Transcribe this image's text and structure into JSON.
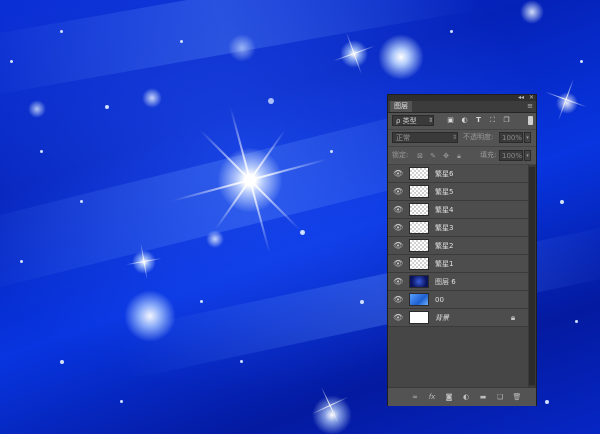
{
  "panel": {
    "tab_label": "图层",
    "kind_filter": "ρ 类型",
    "blend_mode": "正常",
    "opacity_label": "不透明度:",
    "opacity_value": "100%",
    "lock_label": "锁定:",
    "fill_label": "填充:",
    "fill_value": "100%"
  },
  "filter_icons": [
    "image-filter-icon",
    "adjustment-filter-icon",
    "type-filter-icon",
    "shape-filter-icon",
    "smart-object-filter-icon"
  ],
  "lock_icons": [
    "lock-transparent-icon",
    "lock-image-icon",
    "lock-position-icon",
    "lock-all-icon"
  ],
  "layers": [
    {
      "name": "繁星6",
      "thumb": "checker"
    },
    {
      "name": "繁星5",
      "thumb": "checker"
    },
    {
      "name": "繁星4",
      "thumb": "checker"
    },
    {
      "name": "繁星3",
      "thumb": "checker"
    },
    {
      "name": "繁星2",
      "thumb": "checker"
    },
    {
      "name": "繁星1",
      "thumb": "checker"
    },
    {
      "name": "图层 6",
      "thumb": "dark"
    },
    {
      "name": "00",
      "thumb": "pic"
    },
    {
      "name": "背景",
      "thumb": "white",
      "locked": true
    }
  ],
  "footer_icons": [
    "link-layers-icon",
    "fx-icon",
    "add-mask-icon",
    "new-adjustment-icon",
    "new-group-icon",
    "new-layer-icon",
    "delete-icon"
  ],
  "colors": {
    "canvas_blue": "#0626c4",
    "panel_bg": "#535353",
    "star_white": "#ffffff"
  }
}
